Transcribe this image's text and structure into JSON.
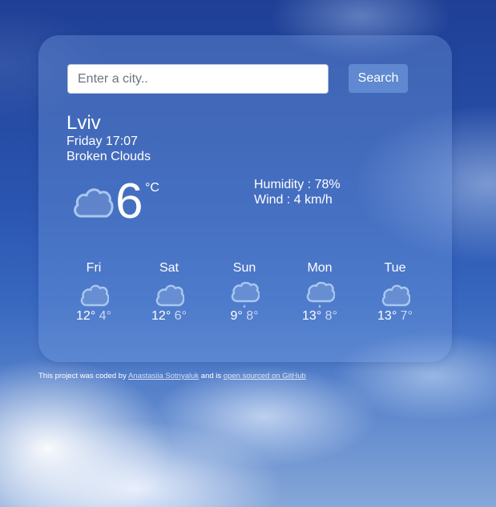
{
  "search": {
    "placeholder": "Enter a city..",
    "value": "",
    "button_label": "Search"
  },
  "current": {
    "city": "Lviv",
    "datetime": "Friday 17:07",
    "description": "Broken Clouds",
    "icon": "cloud-icon",
    "temperature": "6",
    "unit": "°C",
    "humidity": "Humidity : 78%",
    "wind": "Wind : 4 km/h"
  },
  "forecast": [
    {
      "day": "Fri",
      "icon": "cloud-icon",
      "max": "12°",
      "min": "4°"
    },
    {
      "day": "Sat",
      "icon": "cloud-icon",
      "max": "12°",
      "min": "6°"
    },
    {
      "day": "Sun",
      "icon": "rain-cloud-icon",
      "max": "9°",
      "min": "8°"
    },
    {
      "day": "Mon",
      "icon": "rain-cloud-icon",
      "max": "13°",
      "min": "8°"
    },
    {
      "day": "Tue",
      "icon": "cloud-icon",
      "max": "13°",
      "min": "7°"
    }
  ],
  "footer": {
    "prefix": "This project was coded by ",
    "author_link": "Anastasiia Sotnyaluk",
    "middle": " and is ",
    "source_link": "open sourced on GitHub"
  },
  "colors": {
    "icon_fill": "#ffffff",
    "icon_stroke": "#a9c8ef",
    "card_bg": "#789fe1"
  }
}
